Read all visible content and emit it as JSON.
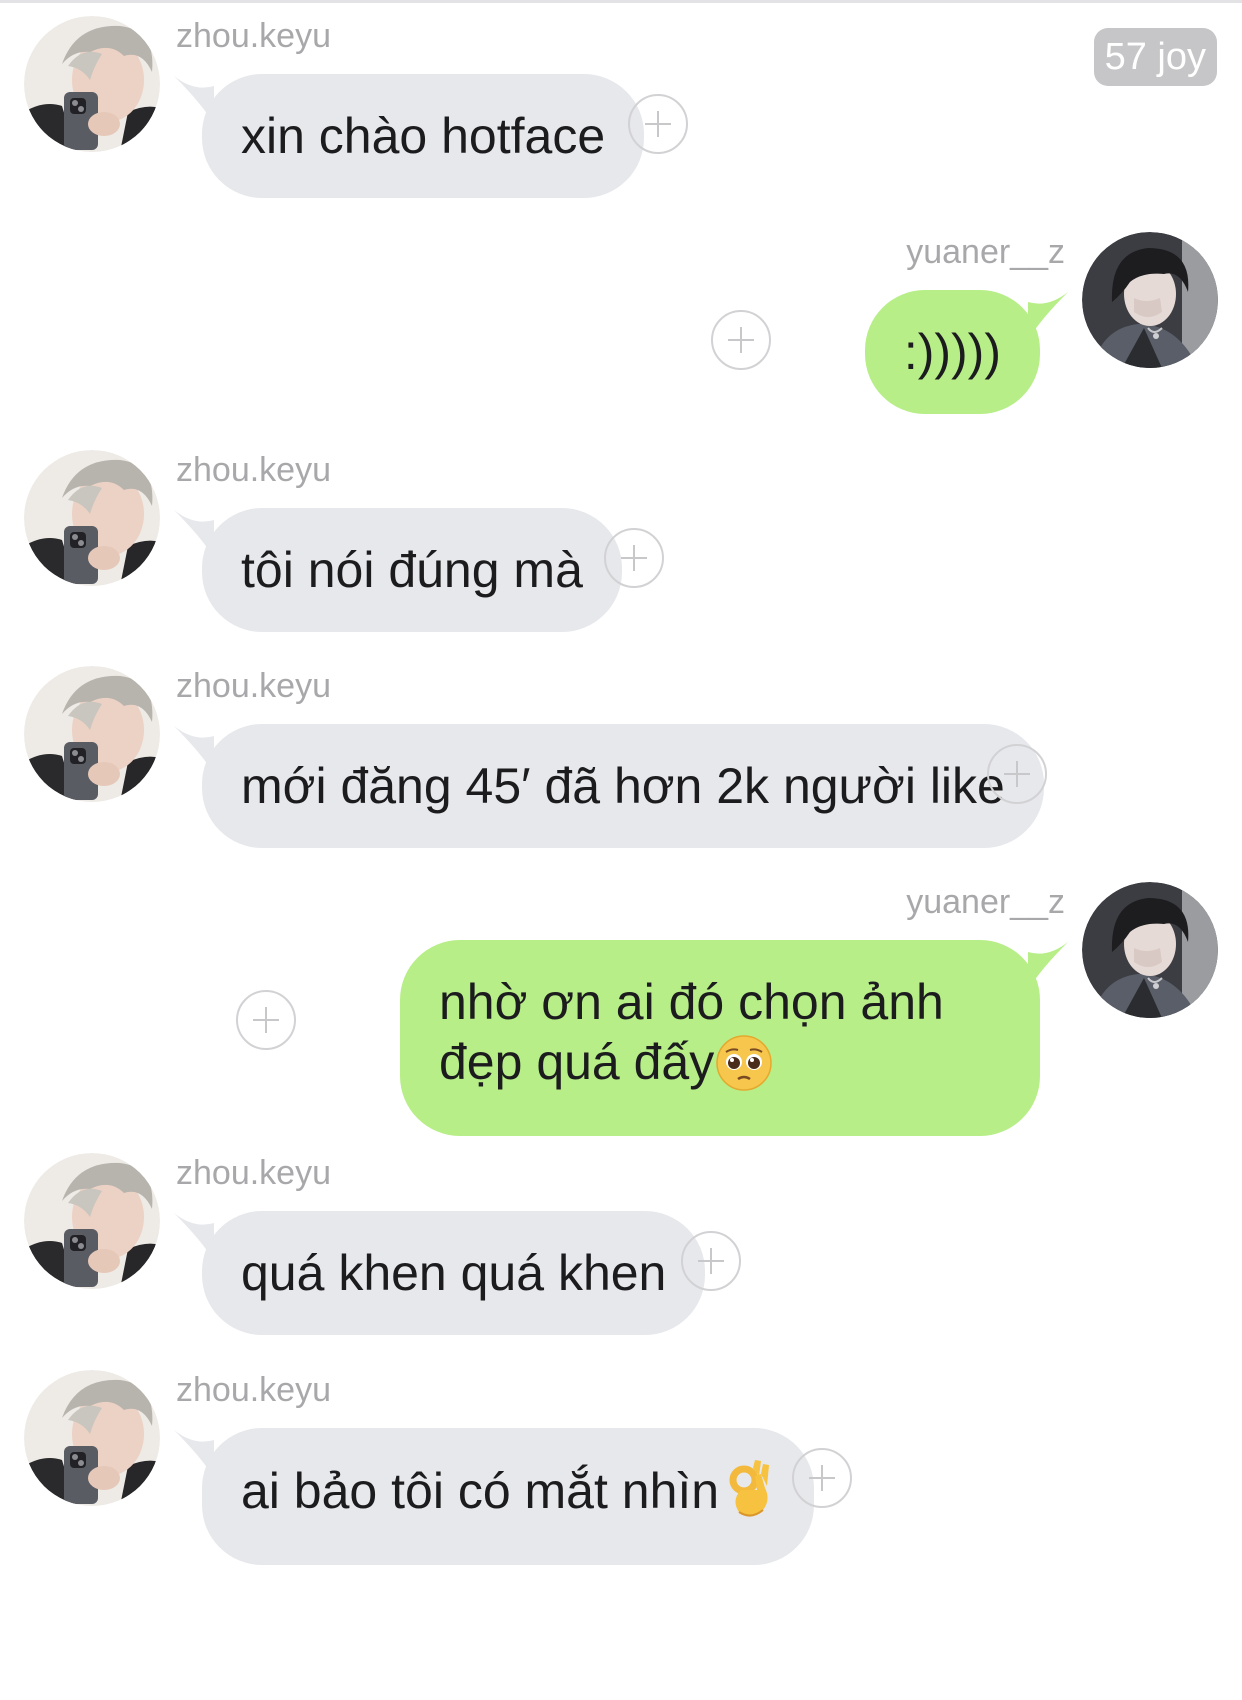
{
  "badge": {
    "label": "57 joy"
  },
  "colors": {
    "incoming_bubble": "#e7e8ec",
    "outgoing_bubble": "#b7ee88",
    "badge": "#c6c6c8"
  },
  "messages": [
    {
      "direction": "in",
      "sender": "zhou.keyu",
      "text": "xin chào hotface",
      "emoji": ""
    },
    {
      "direction": "out",
      "sender": "yuaner__z",
      "text": ":)))))",
      "emoji": ""
    },
    {
      "direction": "in",
      "sender": "zhou.keyu",
      "text": "tôi nói đúng mà",
      "emoji": ""
    },
    {
      "direction": "in",
      "sender": "zhou.keyu",
      "text": "mới đăng 45′ đã hơn 2k người like",
      "emoji": ""
    },
    {
      "direction": "out",
      "sender": "yuaner__z",
      "text": "nhờ ơn ai đó chọn ảnh đẹp quá đấy",
      "emoji": "pleading-face"
    },
    {
      "direction": "in",
      "sender": "zhou.keyu",
      "text": "quá khen quá khen",
      "emoji": ""
    },
    {
      "direction": "in",
      "sender": "zhou.keyu",
      "text": "ai bảo tôi có mắt nhìn",
      "emoji": "ok-hand"
    }
  ]
}
